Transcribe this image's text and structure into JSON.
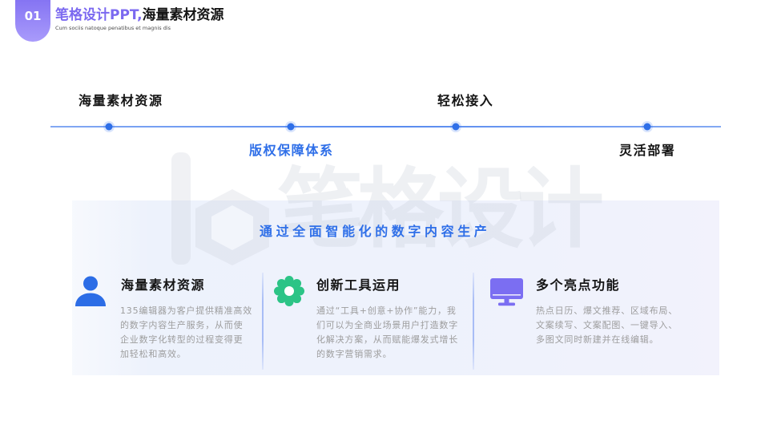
{
  "header": {
    "badge": "01",
    "title_accent": "笔格设计PPT,",
    "title_main": "海量素材资源",
    "subtitle": "Cum sociis natoque penatibus et magnis dis"
  },
  "timeline": {
    "items": [
      {
        "label": "海量素材资源"
      },
      {
        "label": "版权保障体系"
      },
      {
        "label": "轻松接入"
      },
      {
        "label": "灵活部署"
      }
    ]
  },
  "watermark": {
    "text": "笔格设计"
  },
  "panel": {
    "heading": "通过全面智能化的数字内容生产",
    "features": [
      {
        "icon": "user-icon",
        "title": "海量素材资源",
        "body_lines": [
          "135编辑器为客户提供精准高效",
          "的数字内容生产服务，从而使",
          "企业数字化转型的过程变得更",
          "加轻松和高效。"
        ]
      },
      {
        "icon": "gear-icon",
        "title": "创新工具运用",
        "body_lines": [
          "通过“工具+创意+协作”能力，我",
          "们可以为全商业场景用户打造数字",
          "化解决方案，从而赋能爆发式增长",
          "的数字营销需求。"
        ]
      },
      {
        "icon": "monitor-icon",
        "title": "多个亮点功能",
        "body_lines": [
          "热点日历、爆文推荐、区域布局、",
          "文案续写、文案配图、一键导入、",
          "多图文同时新建并在线编辑。"
        ]
      }
    ]
  },
  "colors": {
    "accent_purple": "#7b69f0",
    "accent_blue": "#2f6fe8",
    "icon_blue": "#2c6de6",
    "icon_green": "#2cc486",
    "icon_purple": "#7b6ef2",
    "text_dark": "#151515",
    "text_muted": "#9d9d9d"
  }
}
